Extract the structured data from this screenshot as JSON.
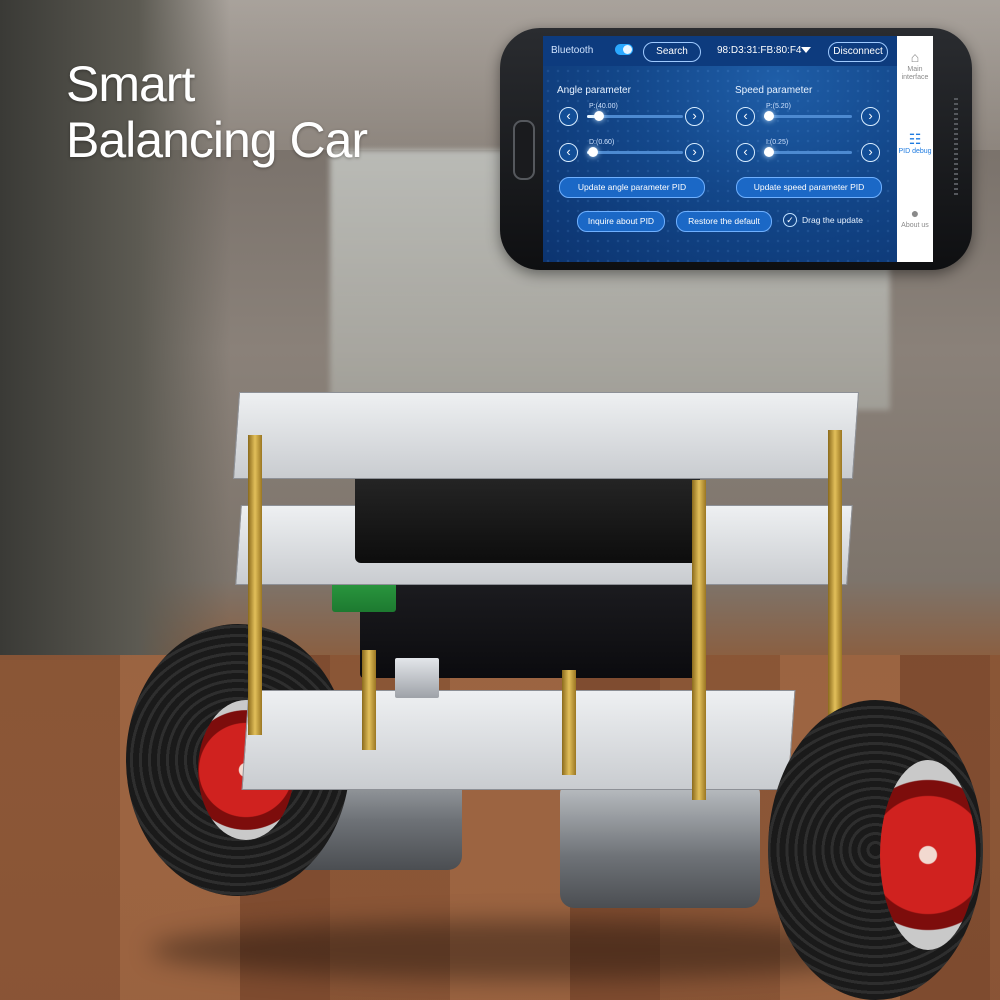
{
  "headline": {
    "line1": "Smart",
    "line2": "Balancing Car"
  },
  "app": {
    "topbar": {
      "bluetooth_label": "Bluetooth",
      "bluetooth_on": true,
      "search_label": "Search",
      "device_address": "98:D3:31:FB:80:F4",
      "disconnect_label": "Disconnect"
    },
    "sidebar": {
      "items": [
        {
          "label": "Main interface",
          "icon": "home-icon",
          "active": false
        },
        {
          "label": "PID debug",
          "icon": "sliders-icon",
          "active": true
        },
        {
          "label": "About us",
          "icon": "person-icon",
          "active": false
        }
      ]
    },
    "angle": {
      "title": "Angle parameter",
      "p": {
        "label": "P:(40.00)",
        "level": 0.12
      },
      "d": {
        "label": "D:(0.60)",
        "level": 0.06
      }
    },
    "speed": {
      "title": "Speed parameter",
      "p": {
        "label": "P:(5.20)",
        "level": 0.06
      },
      "i": {
        "label": "I:(0.25)",
        "level": 0.06
      }
    },
    "buttons": {
      "update_angle": "Update angle parameter PID",
      "update_speed": "Update speed parameter PID",
      "inquire": "Inquire about PID",
      "restore": "Restore the default",
      "drag_update": "Drag the update",
      "drag_update_checked": true
    },
    "colors": {
      "accent": "#1e7be0",
      "screen_bg": "#13478a",
      "toggle": "#2aa8ff"
    }
  },
  "product": {
    "name": "two-wheel balancing robot kit",
    "wheel_hub_color": "#d0221f"
  }
}
